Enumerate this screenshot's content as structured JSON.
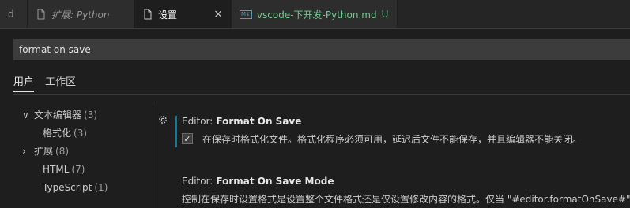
{
  "tabs": [
    {
      "label": "d"
    },
    {
      "label": "扩展: Python"
    },
    {
      "label": "设置",
      "close": "×"
    },
    {
      "badge": "M↓",
      "label": "vscode-下开发-Python.md",
      "status": "U"
    }
  ],
  "search": {
    "value": "format on save"
  },
  "scope_tabs": [
    "用户",
    "工作区"
  ],
  "toc": [
    {
      "chevron": "∨",
      "label": "文本编辑器",
      "count": "(3)"
    },
    {
      "label": "格式化",
      "count": "(3)"
    },
    {
      "chevron": "›",
      "label": "扩展",
      "count": "(8)"
    },
    {
      "label": "HTML",
      "count": "(7)"
    },
    {
      "label": "TypeScript",
      "count": "(1)"
    }
  ],
  "settings": [
    {
      "category": "Editor:",
      "key": "Format On Save",
      "checked": true,
      "description": "在保存时格式化文件。格式化程序必须可用，延迟后文件不能保存，并且编辑器不能关闭。"
    },
    {
      "category": "Editor:",
      "key": "Format On Save Mode",
      "description": "控制在保存时设置格式是设置整个文件格式还是仅设置修改内容的格式。仅当 \"#editor.formatOnSave#\" 为 true 时适用。"
    }
  ],
  "colors": {
    "accent": "#0c7d9d",
    "md_modified": "#73c991"
  }
}
